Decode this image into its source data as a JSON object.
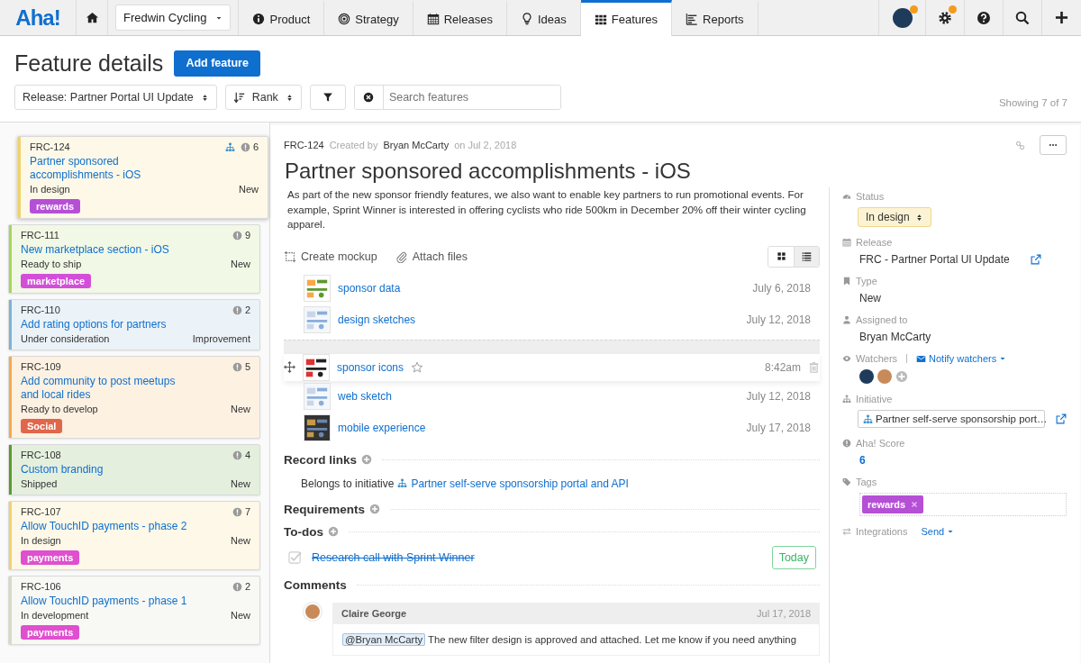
{
  "nav": {
    "logo": "Aha!",
    "workspace": "Fredwin Cycling",
    "tabs": [
      {
        "label": "Product",
        "selected": false
      },
      {
        "label": "Strategy",
        "selected": false
      },
      {
        "label": "Releases",
        "selected": false
      },
      {
        "label": "Ideas",
        "selected": false
      },
      {
        "label": "Features",
        "selected": true
      },
      {
        "label": "Reports",
        "selected": false
      }
    ]
  },
  "header": {
    "title": "Feature details",
    "add_button": "Add feature",
    "release_filter": "Release: Partner Portal UI Update",
    "sort": "Rank",
    "search_placeholder": "Search features",
    "count": "Showing 7 of 7"
  },
  "cards": [
    {
      "ref": "FRC-124",
      "title": "Partner sponsored accomplishments - iOS",
      "status": "In design",
      "type": "New",
      "score": "6",
      "has_initiative": true,
      "selected": true,
      "color": "#f0d36a",
      "tag": {
        "label": "rewards",
        "color": "#b54fd6"
      }
    },
    {
      "ref": "FRC-111",
      "title": "New marketplace section - iOS",
      "status": "Ready to ship",
      "type": "New",
      "score": "9",
      "has_initiative": false,
      "selected": false,
      "color": "#a6d65a",
      "tag": {
        "label": "marketplace",
        "color": "#d44fd9"
      }
    },
    {
      "ref": "FRC-110",
      "title": "Add rating options for partners",
      "status": "Under consideration",
      "type": "Improvement",
      "score": "2",
      "has_initiative": false,
      "selected": false,
      "color": "#7fb2d6"
    },
    {
      "ref": "FRC-109",
      "title": "Add community to post meetups and local rides",
      "status": "Ready to develop",
      "type": "New",
      "score": "5",
      "has_initiative": false,
      "selected": false,
      "color": "#f5a94b",
      "tag": {
        "label": "Social",
        "color": "#e0674b"
      }
    },
    {
      "ref": "FRC-108",
      "title": "Custom branding",
      "status": "Shipped",
      "type": "New",
      "score": "4",
      "has_initiative": false,
      "selected": false,
      "color": "#5a9a2e"
    },
    {
      "ref": "FRC-107",
      "title": "Allow TouchID payments - phase 2",
      "status": "In design",
      "type": "New",
      "score": "7",
      "has_initiative": false,
      "selected": false,
      "color": "#f0d36a",
      "tag": {
        "label": "payments",
        "color": "#df4fcf"
      }
    },
    {
      "ref": "FRC-106",
      "title": "Allow TouchID payments - phase 1",
      "status": "In development",
      "type": "New",
      "score": "2",
      "has_initiative": false,
      "selected": false,
      "color": "#d5dcc0",
      "tag": {
        "label": "payments",
        "color": "#df4fcf"
      }
    }
  ],
  "feature": {
    "ref": "FRC-124",
    "created_by": "Created by",
    "author": "Bryan McCarty",
    "created_on": "on Jul 2, 2018",
    "title": "Partner sponsored accomplishments - iOS",
    "description": "As part of the new sponsor friendly features, we also want to enable key partners to run promotional events. For example, Sprint Winner is interested in offering cyclists who ride 500km in December 20% off their winter cycling apparel.",
    "actions": [
      "Create mockup",
      "Attach files"
    ],
    "view_modes": [
      {
        "kind": "grid",
        "selected": false
      },
      {
        "kind": "list",
        "selected": true
      }
    ],
    "attachments": [
      {
        "name": "sponsor data",
        "date": "July 6, 2018",
        "dragging": false
      },
      {
        "name": "design sketches",
        "date": "July 12, 2018",
        "dragging": false
      },
      {
        "name": "sponsor icons",
        "date": "8:42am",
        "dragging": true
      },
      {
        "name": "web sketch",
        "date": "July 12, 2018",
        "dragging": false
      },
      {
        "name": "mobile experience",
        "date": "July 17, 2018",
        "dragging": false
      }
    ],
    "record_links": {
      "title": "Record links",
      "text": "Belongs to initiative",
      "link": "Partner self-serve sponsorship portal and API"
    },
    "requirements": {
      "title": "Requirements"
    },
    "todos": {
      "title": "To-dos",
      "items": [
        {
          "label": "Research call with Sprint Winner",
          "done": true,
          "due": "Today"
        }
      ]
    },
    "comments": {
      "title": "Comments",
      "items": [
        {
          "author": "Claire George",
          "date": "Jul 17, 2018",
          "mention": "@Bryan McCarty",
          "text": "The new filter design is approved and attached. Let me know if you need anything"
        }
      ]
    }
  },
  "sidebar": {
    "fields": [
      {
        "kind": "status",
        "label": "Status",
        "value": "In design"
      },
      {
        "kind": "release",
        "label": "Release",
        "value": "FRC - Partner Portal UI Update"
      },
      {
        "kind": "text",
        "label": "Type",
        "value": "New"
      },
      {
        "kind": "text",
        "label": "Assigned to",
        "value": "Bryan McCarty"
      },
      {
        "kind": "watchers",
        "label": "Watchers",
        "action": "Notify watchers"
      },
      {
        "kind": "initiative",
        "label": "Initiative",
        "value": "Partner self-serve sponsorship port…"
      },
      {
        "kind": "score",
        "label": "Aha! Score",
        "value": "6"
      },
      {
        "kind": "tags",
        "label": "Tags",
        "tags": [
          {
            "label": "rewards",
            "color": "#b54fd6"
          }
        ]
      },
      {
        "kind": "action",
        "label": "Integrations",
        "action": "Send"
      }
    ]
  }
}
